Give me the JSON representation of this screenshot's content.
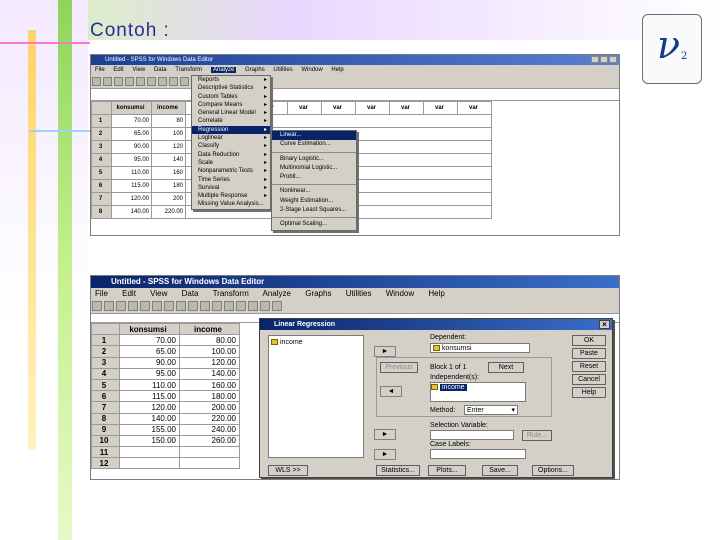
{
  "slide": {
    "title": "Contoh :",
    "logo_symbol": "ν",
    "logo_sub": "2"
  },
  "shot1": {
    "title": "Untitled - SPSS for Windows Data Editor",
    "menus": [
      "File",
      "Edit",
      "View",
      "Data",
      "Transform",
      "Analyze",
      "Graphs",
      "Utilities",
      "Window",
      "Help"
    ],
    "active_menu": "Analyze",
    "columns": [
      "konsumsi",
      "income",
      "var",
      "var",
      "var",
      "var",
      "var",
      "var",
      "var",
      "var",
      "var"
    ],
    "rows": [
      {
        "n": "1",
        "a": "70.00",
        "b": "80"
      },
      {
        "n": "2",
        "a": "65.00",
        "b": "100"
      },
      {
        "n": "3",
        "a": "90.00",
        "b": "120"
      },
      {
        "n": "4",
        "a": "95.00",
        "b": "140"
      },
      {
        "n": "5",
        "a": "110.00",
        "b": "160"
      },
      {
        "n": "6",
        "a": "115.00",
        "b": "180"
      },
      {
        "n": "7",
        "a": "120.00",
        "b": "200"
      },
      {
        "n": "8",
        "a": "140.00",
        "b": "220.00"
      }
    ],
    "analyze_menu": [
      "Reports",
      "Descriptive Statistics",
      "Custom Tables",
      "Compare Means",
      "General Linear Model",
      "Correlate",
      "Regression",
      "Loglinear",
      "Classify",
      "Data Reduction",
      "Scale",
      "Nonparametric Tests",
      "Time Series",
      "Survival",
      "Multiple Response",
      "Missing Value Analysis..."
    ],
    "regression_submenu": [
      "Linear...",
      "Curve Estimation...",
      "",
      "Binary Logistic...",
      "Multinomial Logistic...",
      "Probit...",
      "",
      "Nonlinear...",
      "Weight Estimation...",
      "2-Stage Least Squares...",
      "",
      "Optimal Scaling..."
    ]
  },
  "shot2": {
    "title": "Untitled - SPSS for Windows Data Editor",
    "menus": [
      "File",
      "Edit",
      "View",
      "Data",
      "Transform",
      "Analyze",
      "Graphs",
      "Utilities",
      "Window",
      "Help"
    ],
    "columns": [
      "konsumsi",
      "income"
    ],
    "rows": [
      {
        "n": "1",
        "a": "70.00",
        "b": "80.00"
      },
      {
        "n": "2",
        "a": "65.00",
        "b": "100.00"
      },
      {
        "n": "3",
        "a": "90.00",
        "b": "120.00"
      },
      {
        "n": "4",
        "a": "95.00",
        "b": "140.00"
      },
      {
        "n": "5",
        "a": "110.00",
        "b": "160.00"
      },
      {
        "n": "6",
        "a": "115.00",
        "b": "180.00"
      },
      {
        "n": "7",
        "a": "120.00",
        "b": "200.00"
      },
      {
        "n": "8",
        "a": "140.00",
        "b": "220.00"
      },
      {
        "n": "9",
        "a": "155.00",
        "b": "240.00"
      },
      {
        "n": "10",
        "a": "150.00",
        "b": "260.00"
      },
      {
        "n": "11",
        "a": "",
        "b": ""
      },
      {
        "n": "12",
        "a": "",
        "b": ""
      }
    ],
    "dialog": {
      "title": "Linear Regression",
      "close": "×",
      "variables": [
        "income"
      ],
      "dependent_label": "Dependent:",
      "dependent_value": "konsumsi",
      "previous": "Previous",
      "block": "Block 1 of 1",
      "next": "Next",
      "independent_label": "Independent(s):",
      "independent_value": "income",
      "method_label": "Method:",
      "method_value": "Enter",
      "selection_label": "Selection Variable:",
      "rule": "Rule...",
      "case_label": "Case Labels:",
      "side_buttons": [
        "OK",
        "Paste",
        "Reset",
        "Cancel",
        "Help"
      ],
      "wls": "WLS >>",
      "bottom_buttons": [
        "Statistics...",
        "Plots...",
        "Save...",
        "Options..."
      ],
      "arrow": "►",
      "arrow_left": "◄"
    }
  }
}
